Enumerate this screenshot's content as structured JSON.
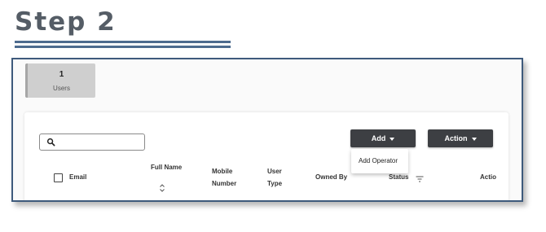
{
  "heading": {
    "title": "Step 2"
  },
  "tiles": [
    {
      "count": "1",
      "label": "Users"
    }
  ],
  "toolbar": {
    "search": {
      "placeholder": "",
      "icon": "search-icon"
    },
    "add_label": "Add",
    "action_label": "Action",
    "button_color": "#3d3f43"
  },
  "add_menu": {
    "items": [
      {
        "label": "Add Operator"
      }
    ]
  },
  "table": {
    "columns": [
      {
        "line1": "Email",
        "line2": ""
      },
      {
        "line1": "Full Name",
        "line2": ""
      },
      {
        "line1": "Mobile",
        "line2": "Number"
      },
      {
        "line1": "User",
        "line2": "Type"
      },
      {
        "line1": "Owned By",
        "line2": ""
      },
      {
        "line1": "Status",
        "line2": ""
      },
      {
        "line1": "Actio",
        "line2": ""
      }
    ]
  },
  "colors": {
    "accent": "#4d6b8e",
    "frame_border": "#3e5a7c"
  }
}
